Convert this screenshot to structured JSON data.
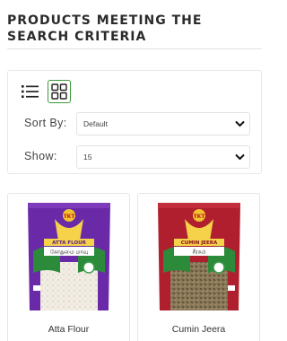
{
  "page": {
    "heading_line1": "PRODUCTS MEETING THE",
    "heading_line2": "SEARCH CRITERIA"
  },
  "filters": {
    "sort_label": "Sort By:",
    "sort_value": "Default",
    "show_label": "Show:",
    "show_value": "15",
    "active_view": "grid"
  },
  "colors": {
    "accent_green": "#3a9b3a",
    "atta_pack_purple": "#6a2aa8",
    "jeera_pack_red": "#b01f2e"
  },
  "products": [
    {
      "name": "Atta Flour",
      "pack_title": "ATTA FLOUR",
      "pack_subtitle": "கோதுமை மாவு",
      "brand": "TKT",
      "image_icon": "atta-flour-pack"
    },
    {
      "name": "Cumin Jeera",
      "pack_title": "CUMIN JEERA",
      "pack_subtitle": "சீரகம்",
      "brand": "TKT",
      "image_icon": "cumin-jeera-pack"
    }
  ]
}
